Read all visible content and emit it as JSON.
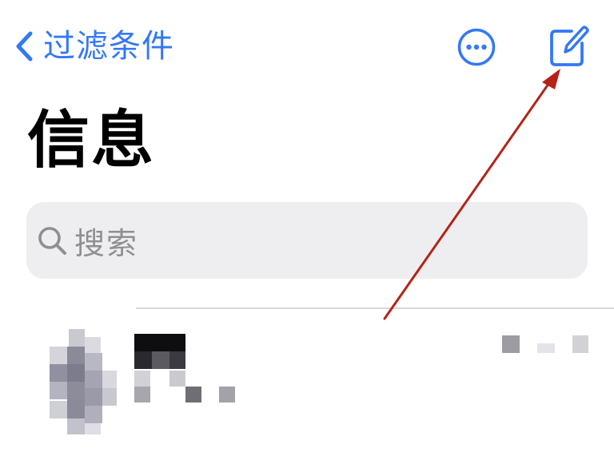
{
  "nav": {
    "back_label": "过滤条件",
    "more_icon": "ellipsis-circle-icon",
    "compose_icon": "square-and-pencil-icon"
  },
  "page": {
    "title": "信息"
  },
  "search": {
    "placeholder": "搜索",
    "icon": "magnifying-glass-icon"
  },
  "conversation_row": {
    "name": "",
    "preview": "",
    "time": "",
    "pixelated": true
  },
  "annotation": {
    "type": "arrow",
    "color": "#B42318",
    "points_to": "compose-button"
  },
  "colors": {
    "accent": "#3478F6",
    "search_bg": "#EEEEF0",
    "placeholder": "#8E8E93",
    "title": "#000000"
  }
}
